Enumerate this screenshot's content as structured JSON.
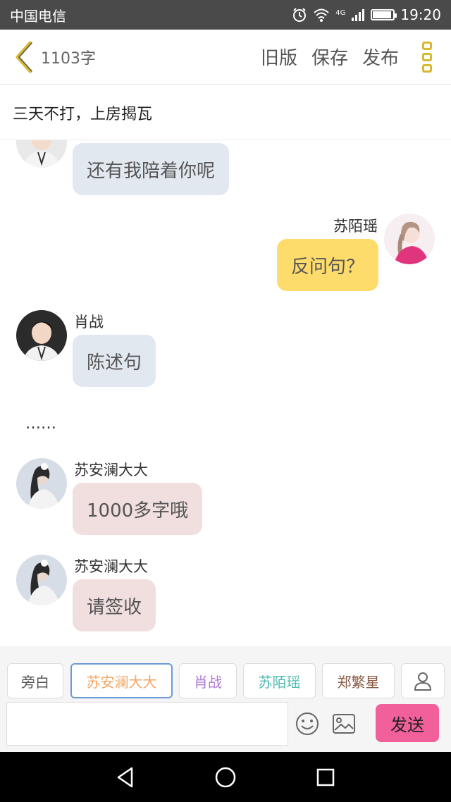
{
  "status_bar": {
    "carrier": "中国电信",
    "network": "4G",
    "time": "19:20",
    "icons": [
      "alarm-icon",
      "wifi-icon",
      "signal-icon",
      "battery-icon"
    ],
    "battery_level": 0.85
  },
  "header": {
    "back_icon": "chevron-left-icon",
    "word_count": "1103字",
    "old_version_label": "旧版",
    "save_label": "保存",
    "publish_label": "发布",
    "more_icon": "more-vertical-icon",
    "accent_color": "#d9b933"
  },
  "story_title": "三天不打，上房揭瓦",
  "messages": [
    {
      "text": "还有我陪着你呢"
    },
    {
      "sender": "苏陌瑶",
      "text": "反问句？"
    },
    {
      "sender": "肖战",
      "text": "陈述句"
    },
    {
      "text": "……"
    },
    {
      "sender": "苏安澜大大",
      "text": "1000多字哦"
    },
    {
      "sender": "苏安澜大大",
      "text": "请签收"
    }
  ],
  "role_tabs": [
    {
      "label": "旁白",
      "color": "#555555"
    },
    {
      "label": "苏安澜大大",
      "color": "#f2a664",
      "active": true
    },
    {
      "label": "肖战",
      "color": "#b07ad6"
    },
    {
      "label": "苏陌瑶",
      "color": "#4dbab0"
    },
    {
      "label": "郑繁星",
      "color": "#8a5a44"
    },
    {
      "icon": "person-icon"
    }
  ],
  "input": {
    "placeholder": "",
    "emoji_icon": "emoji-icon",
    "image_icon": "image-icon",
    "send_label": "发送",
    "send_color": "#f1609b"
  },
  "nav_bar": {
    "icons": [
      "back-triangle-icon",
      "home-circle-icon",
      "recents-square-icon"
    ]
  }
}
